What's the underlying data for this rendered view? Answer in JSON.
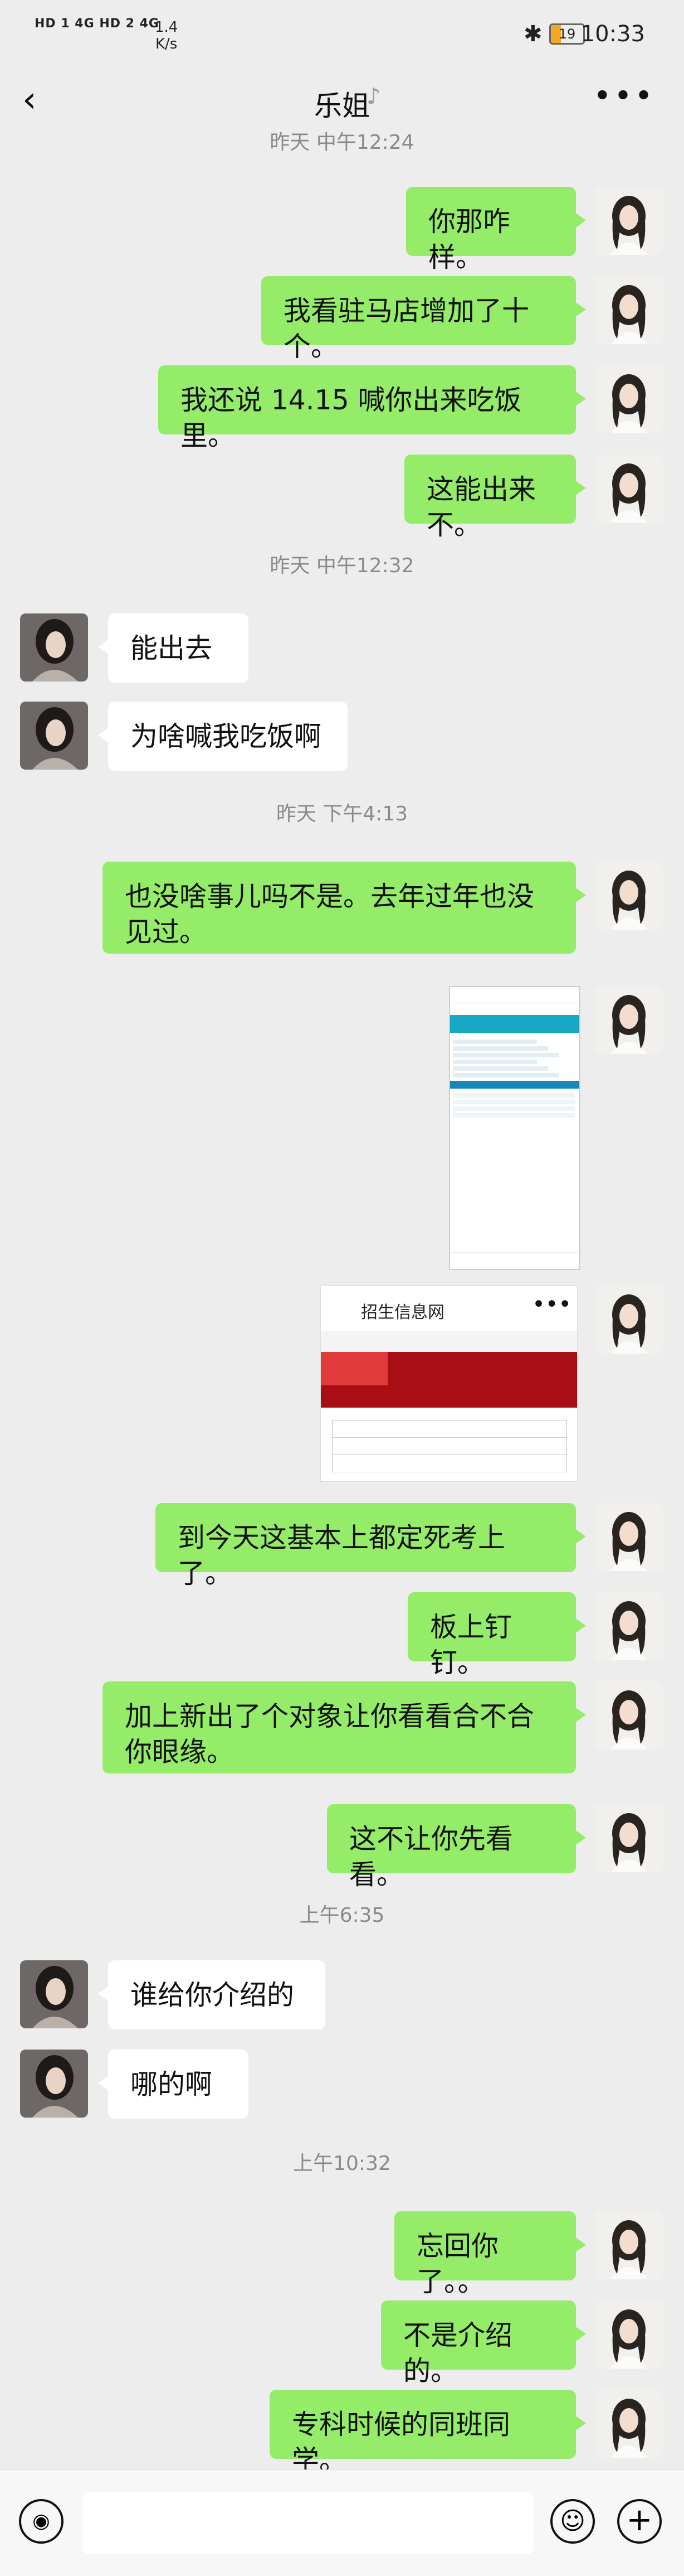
{
  "status_bar": {
    "left_indicators": "HD 1 4G  HD 2 4G",
    "net_speed_value": "1.4",
    "net_speed_unit": "K/s",
    "bluetooth": "✱",
    "battery": "19",
    "time": "10:33"
  },
  "nav": {
    "back_icon": "chevron-left",
    "title": "乐姐",
    "ear_icon": "ear",
    "more_icon": "more-dots"
  },
  "messages": [
    {
      "type": "timestamp",
      "text": "昨天 中午12:24"
    },
    {
      "type": "text",
      "from": "me",
      "text": "你那咋样。"
    },
    {
      "type": "text",
      "from": "me",
      "text": "我看驻马店增加了十个。"
    },
    {
      "type": "text",
      "from": "me",
      "text": "我还说 14.15 喊你出来吃饭里。"
    },
    {
      "type": "text",
      "from": "me",
      "text": "这能出来不。"
    },
    {
      "type": "timestamp",
      "text": "昨天 中午12:32"
    },
    {
      "type": "text",
      "from": "her",
      "text": "能出去"
    },
    {
      "type": "text",
      "from": "her",
      "text": "为啥喊我吃饭啊"
    },
    {
      "type": "timestamp",
      "text": "昨天 下午4:13"
    },
    {
      "type": "text",
      "from": "me",
      "text": "也没啥事儿吗不是。去年过年也没见过。"
    },
    {
      "type": "image",
      "from": "me",
      "kind": "phone-screenshot"
    },
    {
      "type": "image",
      "from": "me",
      "kind": "web-card",
      "title": "招生信息网"
    },
    {
      "type": "text",
      "from": "me",
      "text": "到今天这基本上都定死考上了。"
    },
    {
      "type": "text",
      "from": "me",
      "text": "板上钉钉。"
    },
    {
      "type": "text",
      "from": "me",
      "text": "加上新出了个对象让你看看合不合你眼缘。"
    },
    {
      "type": "text",
      "from": "me",
      "text": "这不让你先看看。"
    },
    {
      "type": "timestamp",
      "text": "上午6:35"
    },
    {
      "type": "text",
      "from": "her",
      "text": "谁给你介绍的"
    },
    {
      "type": "text",
      "from": "her",
      "text": "哪的啊"
    },
    {
      "type": "timestamp",
      "text": "上午10:32"
    },
    {
      "type": "text",
      "from": "me",
      "text": "忘回你了。。"
    },
    {
      "type": "text",
      "from": "me",
      "text": "不是介绍的。"
    },
    {
      "type": "text",
      "from": "me",
      "text": "专科时候的同班同学。"
    }
  ],
  "input_bar": {
    "voice_icon": "voice",
    "emoji_icon": "emoji",
    "plus_icon": "plus",
    "input_value": ""
  },
  "colors": {
    "background": "#ededed",
    "my_bubble": "#95ec69",
    "her_bubble": "#ffffff"
  }
}
